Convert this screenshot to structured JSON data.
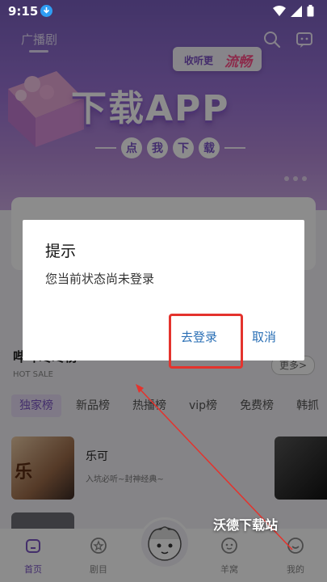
{
  "status_bar": {
    "time": "9:15"
  },
  "header": {
    "tab_label": "广播剧"
  },
  "banner": {
    "chip_text_a": "收听更",
    "chip_text_b": "流畅",
    "headline": "下载APP",
    "sub_chars": [
      "点",
      "我",
      "下",
      "载"
    ]
  },
  "rank": {
    "title": "哔哔咚咚榜",
    "subtitle": "HOT SALE",
    "more_label": "更多"
  },
  "tabs": [
    "独家榜",
    "新品榜",
    "热播榜",
    "vip榜",
    "免费榜",
    "韩抓"
  ],
  "list": [
    {
      "title": "乐可",
      "desc": "入坑必听~封神经典~",
      "cover_text": "乐"
    }
  ],
  "dialog": {
    "title": "提示",
    "message": "您当前状态尚未登录",
    "login_label": "去登录",
    "cancel_label": "取消"
  },
  "bottom_nav": [
    {
      "label": "首页",
      "icon": "home-icon",
      "active": true
    },
    {
      "label": "剧目",
      "icon": "star-icon",
      "active": false
    },
    {
      "label": "",
      "icon": "avatar-icon",
      "active": false
    },
    {
      "label": "羊窝",
      "icon": "sheep-icon",
      "active": false
    },
    {
      "label": "我的",
      "icon": "profile-icon",
      "active": false
    }
  ],
  "watermark": "沃德下载站",
  "colors": {
    "accent": "#7a54c4",
    "dialog_button": "#2a6fb5",
    "highlight": "#e4332d"
  }
}
